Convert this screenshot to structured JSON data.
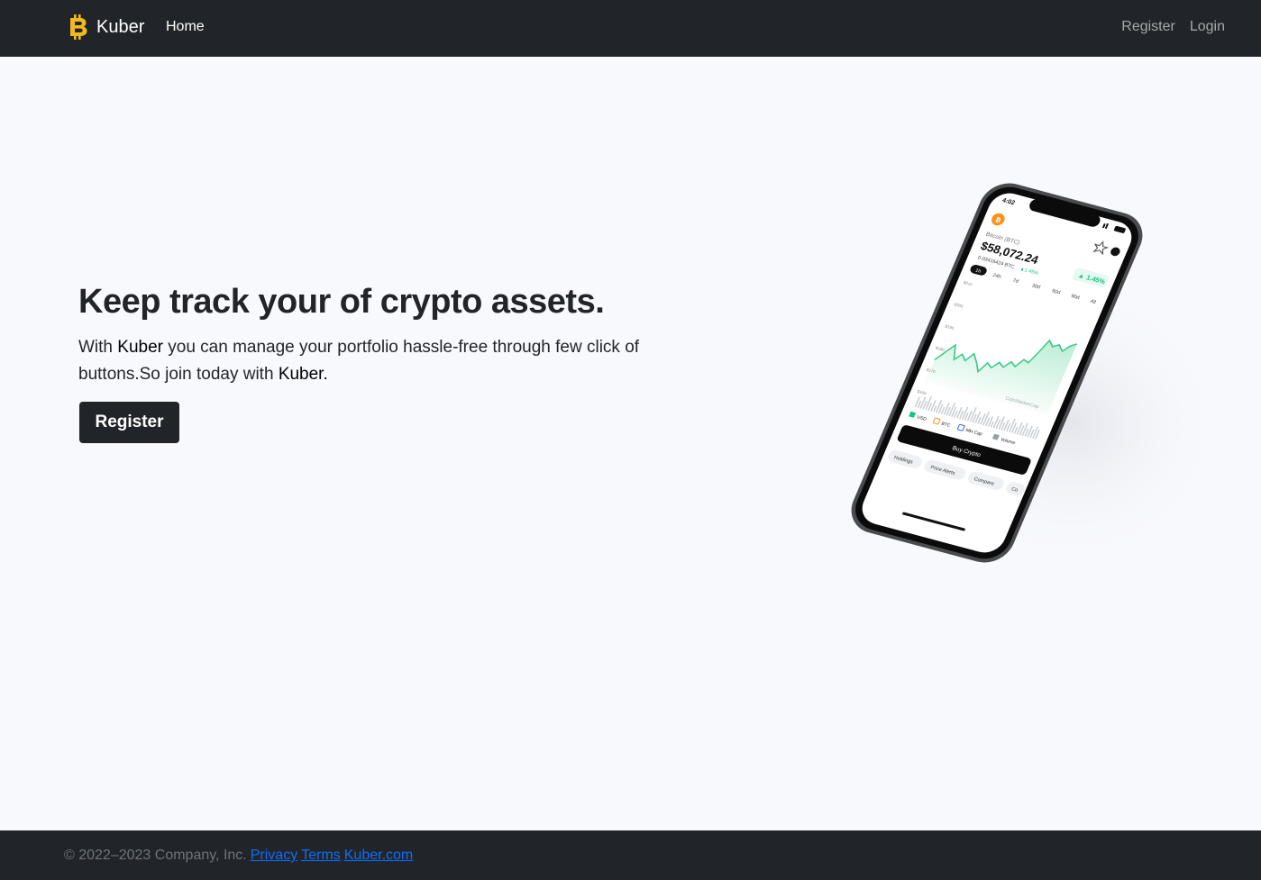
{
  "nav": {
    "brand": "Kuber",
    "home": "Home",
    "register": "Register",
    "login": "Login"
  },
  "hero": {
    "title": "Keep track your of crypto assets.",
    "lead_1": "With ",
    "lead_brand_1": "Kuber",
    "lead_2": " you can manage your portfolio hassle-free through few click of buttons.So join today with ",
    "lead_brand_2": "Kuber.",
    "button": "Register"
  },
  "phone": {
    "time": "4:02",
    "coin": "Bitcoin (BTC)",
    "price": "$58,072.24",
    "sub": "0.03416424 BTC",
    "sub_change": "▲1.45%",
    "change": "▲ 1.45%",
    "ranges": [
      "1h",
      "24h",
      "7d",
      "30d",
      "60d",
      "90d",
      "All"
    ],
    "y_ticks": [
      "$210",
      "$200",
      "$190",
      "$180",
      "$170",
      "$160"
    ],
    "watermark": "CoinMarketCap",
    "legend": [
      "USD",
      "BTC",
      "Mkt Cap",
      "Volume"
    ],
    "buy": "Buy Crypto",
    "chips": [
      "Holdings",
      "Price Alerts",
      "Compare",
      "Co"
    ]
  },
  "footer": {
    "copyright": "© 2022–2023 Company, Inc.",
    "privacy": "Privacy",
    "terms": "Terms",
    "site": "Kuber.com"
  },
  "colors": {
    "nav_bg": "#212529",
    "page_bg": "#f8f9fd",
    "brand_icon": "#f2b91e",
    "link": "#0d6efd",
    "chart_green": "#3dca86"
  }
}
